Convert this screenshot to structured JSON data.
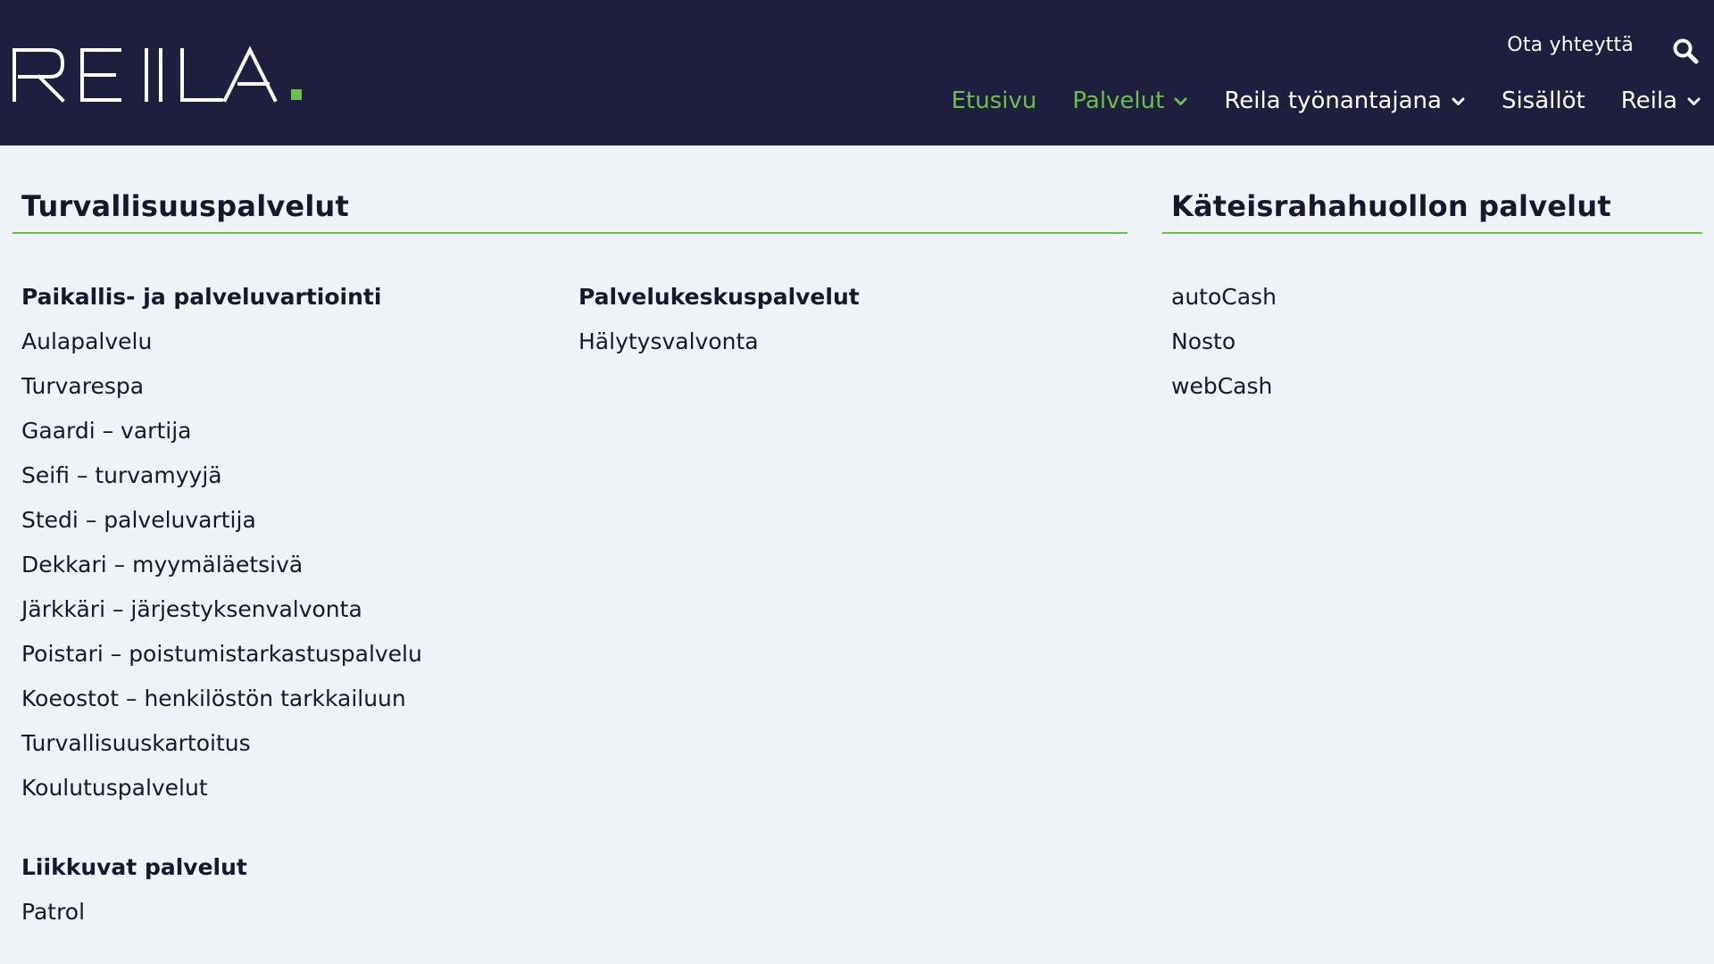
{
  "header": {
    "brand": "REILA.",
    "contact_label": "Ota yhteyttä",
    "nav": [
      {
        "label": "Etusivu",
        "active": true,
        "dropdown": false
      },
      {
        "label": "Palvelut",
        "active": true,
        "dropdown": true
      },
      {
        "label": "Reila työnantajana",
        "active": false,
        "dropdown": true
      },
      {
        "label": "Sisällöt",
        "active": false,
        "dropdown": false
      },
      {
        "label": "Reila",
        "active": false,
        "dropdown": true
      }
    ]
  },
  "menu": {
    "security": {
      "title": "Turvallisuuspalvelut",
      "col1": {
        "heading": "Paikallis- ja palveluvartiointi",
        "items": [
          "Aulapalvelu",
          "Turvarespa",
          "Gaardi – vartija",
          "Seifi – turvamyyjä",
          "Stedi – palveluvartija",
          "Dekkari – myymäläetsivä",
          "Järkkäri – järjestyksenvalvonta",
          "Poistari – poistumistarkastuspalvelu",
          "Koeostot – henkilöstön tarkkailuun",
          "Turvallisuuskartoitus",
          "Koulutuspalvelut"
        ],
        "heading2": "Liikkuvat palvelut",
        "items2": [
          "Patrol"
        ]
      },
      "col2": {
        "heading": "Palvelukeskuspalvelut",
        "items": [
          "Hälytysvalvonta"
        ]
      }
    },
    "cash": {
      "title": "Käteisrahahuollon palvelut",
      "items": [
        "autoCash",
        "Nosto",
        "webCash"
      ]
    }
  },
  "colors": {
    "header_bg": "#1e1f3e",
    "page_bg": "#eef3f8",
    "accent": "#6cc04a",
    "text": "#16182b"
  }
}
